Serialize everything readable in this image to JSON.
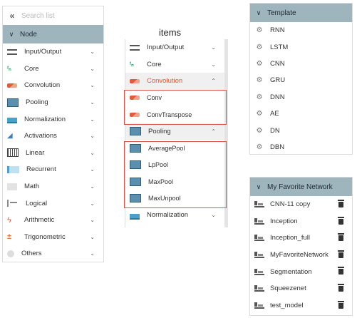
{
  "left_panel": {
    "search_placeholder": "Search list",
    "collapse_glyph": "«",
    "header": "Node",
    "header_chevron": "∨",
    "items": [
      {
        "label": "Input/Output",
        "icon": "input-output-icon"
      },
      {
        "label": "Core",
        "icon": "core-icon"
      },
      {
        "label": "Convolution",
        "icon": "convolution-icon"
      },
      {
        "label": "Pooling",
        "icon": "pooling-icon"
      },
      {
        "label": "Normalization",
        "icon": "normalization-icon"
      },
      {
        "label": "Activations",
        "icon": "activations-icon"
      },
      {
        "label": "Linear",
        "icon": "linear-icon"
      },
      {
        "label": "Recurrent",
        "icon": "recurrent-icon"
      },
      {
        "label": "Math",
        "icon": "math-icon"
      },
      {
        "label": "Logical",
        "icon": "logical-icon"
      },
      {
        "label": "Arithmetic",
        "icon": "arithmetic-icon"
      },
      {
        "label": "Trigonometric",
        "icon": "trigonometric-icon"
      },
      {
        "label": "Others",
        "icon": "others-icon"
      }
    ]
  },
  "items_panel": {
    "title": "items",
    "rows": [
      {
        "label": "Input/Output",
        "expanded": false
      },
      {
        "label": "Core",
        "expanded": false
      },
      {
        "label": "Convolution",
        "expanded": true,
        "accent": "#e05b3b"
      },
      {
        "label": "Conv",
        "sub": true
      },
      {
        "label": "ConvTranspose",
        "sub": true
      },
      {
        "label": "Pooling",
        "expanded": true
      },
      {
        "label": "AveragePool",
        "sub": true
      },
      {
        "label": "LpPool",
        "sub": true
      },
      {
        "label": "MaxPool",
        "sub": true
      },
      {
        "label": "MaxUnpool",
        "sub": true
      },
      {
        "label": "Normalization",
        "expanded": false
      }
    ]
  },
  "template_panel": {
    "header": "Template",
    "items": [
      "RNN",
      "LSTM",
      "CNN",
      "GRU",
      "DNN",
      "AE",
      "DN",
      "DBN"
    ]
  },
  "favorite_panel": {
    "header": "My Favorite Network",
    "items": [
      "CNN-11 copy",
      "Inception",
      "Inception_full",
      "MyFavoriteNetwork",
      "Segmentation",
      "Squeezenet",
      "test_model"
    ]
  },
  "colors": {
    "header_bg": "#9fb5be",
    "highlight_border": "#d9534f"
  }
}
